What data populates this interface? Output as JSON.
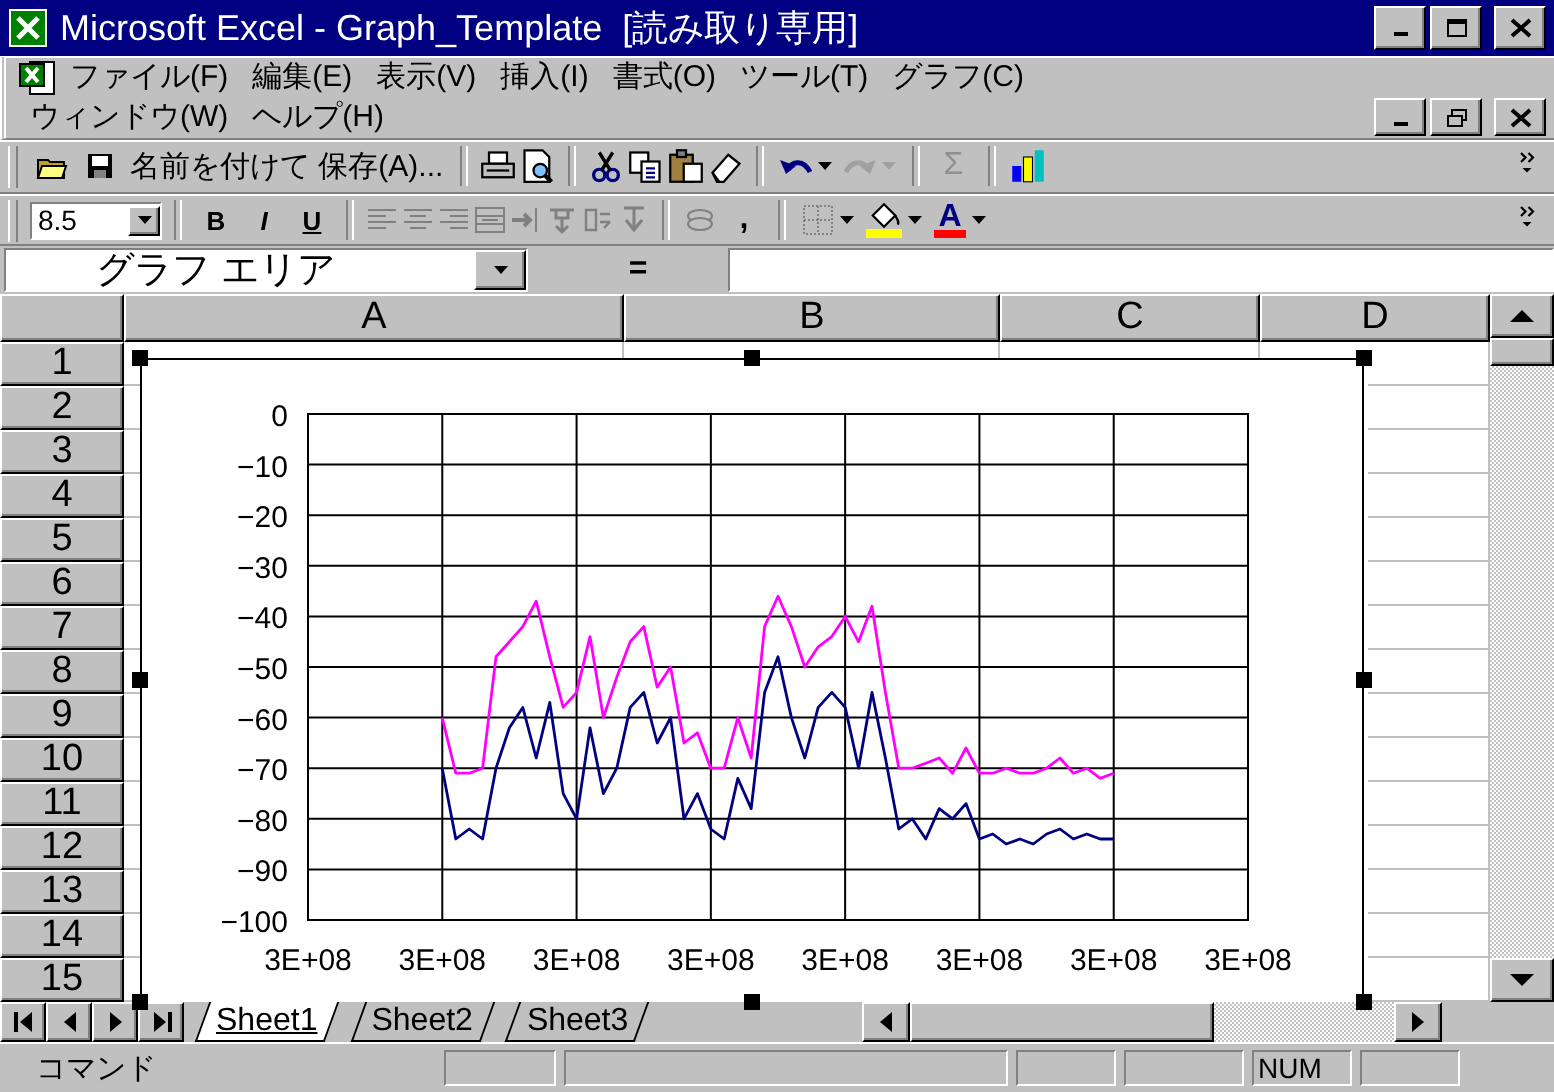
{
  "window": {
    "title": "Microsoft Excel - Graph_Template  [読み取り専用]"
  },
  "menu_bar": {
    "rows": [
      {
        "items": [
          "ファイル(F)",
          "編集(E)",
          "表示(V)",
          "挿入(I)",
          "書式(O)",
          "ツール(T)",
          "グラフ(C)"
        ]
      },
      {
        "items": [
          "ウィンドウ(W)",
          "ヘルプ(H)"
        ]
      }
    ]
  },
  "standard_toolbar": {
    "save_as_button": "名前を付けて 保存(A)...",
    "undo_button": {
      "disabled": false
    },
    "redo_button": {
      "disabled": true
    },
    "sum_button": {
      "label": "Σ",
      "disabled": true
    }
  },
  "formatting_toolbar": {
    "font_size": "8.5",
    "style_buttons": [
      "B",
      "I",
      "U"
    ],
    "comma_button": ",",
    "font_color_button": "A"
  },
  "formula_bar": {
    "name_box": "グラフ エリア",
    "equals_button": "="
  },
  "sheet": {
    "columns": [
      "A",
      "B",
      "C",
      "D"
    ],
    "rows": [
      "1",
      "2",
      "3",
      "4",
      "5",
      "6",
      "7",
      "8",
      "9",
      "10",
      "11",
      "12",
      "13",
      "14",
      "15"
    ]
  },
  "chart": {
    "chart_data": {
      "type": "line",
      "grid": true,
      "ylim": [
        -100,
        0
      ],
      "yticks": [
        0,
        -10,
        -20,
        -30,
        -40,
        -50,
        -60,
        -70,
        -80,
        -90,
        -100
      ],
      "categories": [
        "3E+08",
        null,
        null,
        null,
        null,
        null,
        null,
        null,
        null,
        null,
        "3E+08",
        null,
        null,
        null,
        null,
        null,
        null,
        null,
        null,
        null,
        "3E+08",
        null,
        null,
        null,
        null,
        null,
        null,
        null,
        null,
        null,
        "3E+08",
        null,
        null,
        null,
        null,
        null,
        null,
        null,
        null,
        null,
        "3E+08",
        null,
        null,
        null,
        null,
        null,
        null,
        null,
        null,
        null,
        "3E+08",
        null,
        null,
        null,
        null,
        null,
        null,
        null,
        null,
        null,
        "3E+08",
        null,
        null,
        null,
        null,
        null,
        null,
        null,
        null,
        null,
        "3E+08"
      ],
      "series": [
        {
          "color": "#ff00ff",
          "values": [
            null,
            null,
            null,
            null,
            null,
            null,
            null,
            null,
            null,
            null,
            -60,
            -71,
            -71,
            -70,
            -48,
            -45,
            -42,
            -37,
            -48,
            -58,
            -55,
            -44,
            -60,
            -52,
            -45,
            -42,
            -54,
            -50,
            -65,
            -63,
            -70,
            -70,
            -60,
            -68,
            -42,
            -36,
            -42,
            -50,
            -46,
            -44,
            -40,
            -45,
            -38,
            -55,
            -70,
            -70,
            -69,
            -68,
            -71,
            -66,
            -71,
            -71,
            -70,
            -71,
            -71,
            -70,
            -68,
            -71,
            -70,
            -72,
            -71,
            null,
            null,
            null,
            null,
            null,
            null,
            null,
            null,
            null,
            null
          ]
        },
        {
          "color": "#000080",
          "values": [
            null,
            null,
            null,
            null,
            null,
            null,
            null,
            null,
            null,
            null,
            -70,
            -84,
            -82,
            -84,
            -70,
            -62,
            -58,
            -68,
            -57,
            -75,
            -80,
            -62,
            -75,
            -70,
            -58,
            -55,
            -65,
            -60,
            -80,
            -75,
            -82,
            -84,
            -72,
            -78,
            -55,
            -48,
            -60,
            -68,
            -58,
            -55,
            -58,
            -70,
            -55,
            -68,
            -82,
            -80,
            -84,
            -78,
            -80,
            -77,
            -84,
            -83,
            -85,
            -84,
            -85,
            -83,
            -82,
            -84,
            -83,
            -84,
            -84,
            null,
            null,
            null,
            null,
            null,
            null,
            null,
            null,
            null,
            null
          ]
        }
      ]
    }
  },
  "sheet_tabs": [
    {
      "label": "Sheet1",
      "selected": true
    },
    {
      "label": "Sheet2",
      "selected": false
    },
    {
      "label": "Sheet3",
      "selected": false
    }
  ],
  "status_bar": {
    "mode": "コマンド",
    "num_lock": "NUM"
  }
}
